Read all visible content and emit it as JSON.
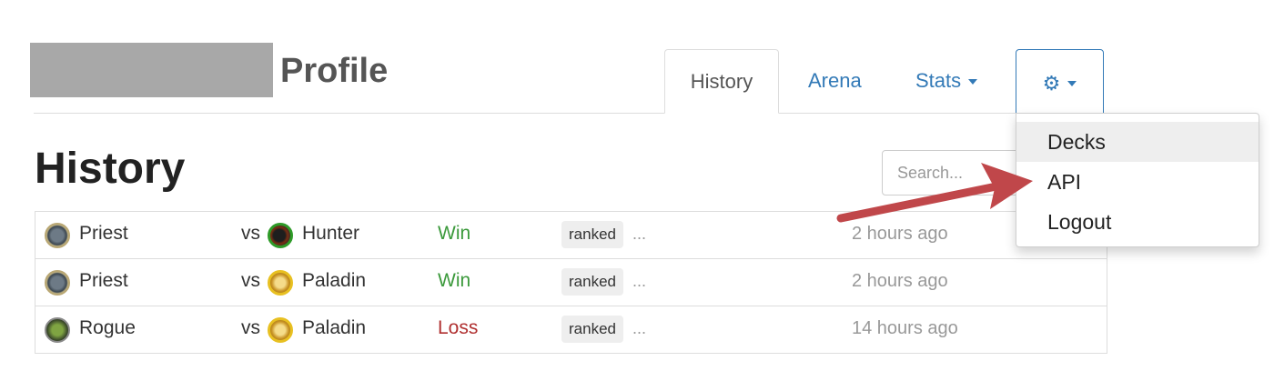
{
  "header": {
    "title": "Profile"
  },
  "tabs": {
    "history": "History",
    "arena": "Arena",
    "stats": "Stats",
    "settings_icon": "gear-icon"
  },
  "page": {
    "heading": "History"
  },
  "search": {
    "placeholder": "Search..."
  },
  "rows": [
    {
      "player_class": "Priest",
      "vs": "vs",
      "opponent_class": "Hunter",
      "result": "Win",
      "mode": "ranked",
      "more": "...",
      "time": "2 hours ago"
    },
    {
      "player_class": "Priest",
      "vs": "vs",
      "opponent_class": "Paladin",
      "result": "Win",
      "mode": "ranked",
      "more": "...",
      "time": "2 hours ago"
    },
    {
      "player_class": "Rogue",
      "vs": "vs",
      "opponent_class": "Paladin",
      "result": "Loss",
      "mode": "ranked",
      "more": "...",
      "time": "14 hours ago"
    }
  ],
  "dropdown": {
    "items": [
      "Decks",
      "API",
      "Logout"
    ]
  },
  "colors": {
    "link": "#337ab7",
    "win": "#3c9a3c",
    "loss": "#b03030",
    "arrow": "#c0474a"
  }
}
